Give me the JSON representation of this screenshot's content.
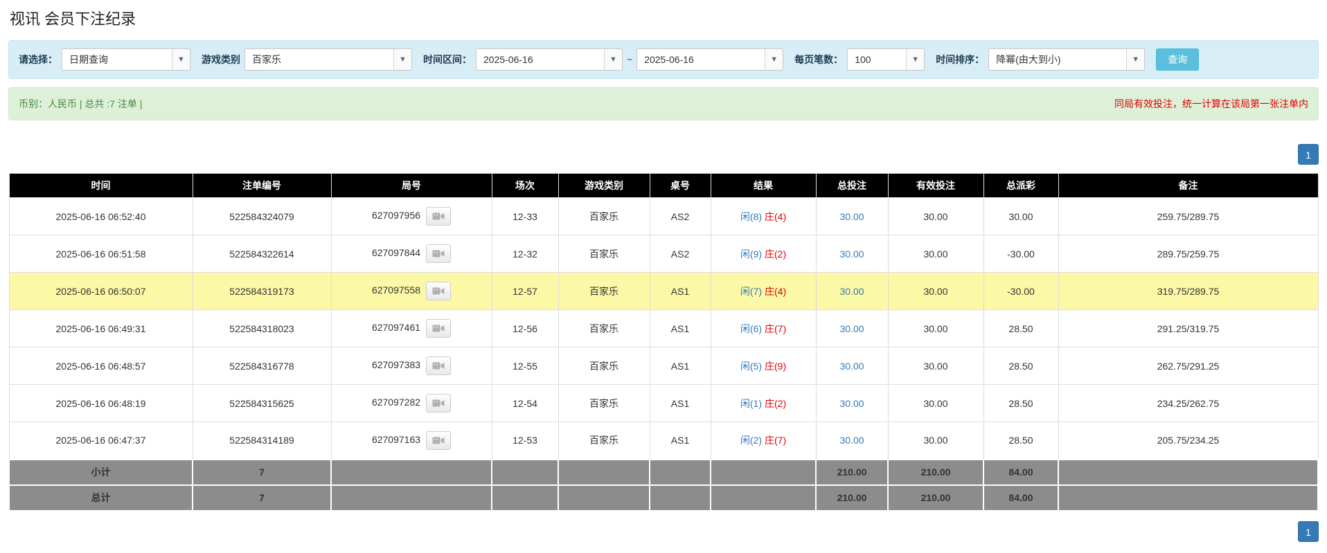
{
  "page": {
    "title": "视讯 会员下注纪录"
  },
  "filters": {
    "query_type": {
      "label": "请选择：",
      "value": "日期查询"
    },
    "game_category": {
      "label": "游戏类别",
      "value": "百家乐"
    },
    "time_range": {
      "label": "时间区间：",
      "from": "2025-06-16",
      "separator": "~",
      "to": "2025-06-16"
    },
    "page_size": {
      "label": "每页笔数：",
      "value": "100"
    },
    "time_sort": {
      "label": "时间排序：",
      "value": "降幂(由大到小)"
    },
    "search_button_label": "查询"
  },
  "summary": {
    "left_text": "币别：人民币 | 总共 :7 注单 |",
    "right_notice": "同局有效投注，统一计算在该局第一张注单内"
  },
  "pagination": {
    "current_page": "1"
  },
  "icons": {
    "dropdown": "▼",
    "video_replay": "video-camera"
  },
  "colors": {
    "accent_blue": "#337ab7",
    "result_red": "#e00000",
    "search_button_bg": "#5bc0de",
    "highlight_row": "#fbf8a6",
    "table_header_bg": "#000000",
    "totals_row_bg": "#8c8c8c",
    "filter_bar_bg": "#d9edf7",
    "summary_bar_bg": "#dff0d8"
  },
  "table": {
    "headers": [
      "时间",
      "注单编号",
      "局号",
      "场次",
      "游戏类别",
      "桌号",
      "结果",
      "总投注",
      "有效投注",
      "总派彩",
      "备注"
    ],
    "rows": [
      {
        "time": "2025-06-16 06:52:40",
        "bet_id": "522584324079",
        "round_no": "627097956",
        "session": "12-33",
        "game": "百家乐",
        "table_no": "AS2",
        "result_player": "闲(8)",
        "result_banker": "庄(4)",
        "total_bet": "30.00",
        "valid_bet": "30.00",
        "payout": "30.00",
        "note": "259.75/289.75",
        "highlighted": false
      },
      {
        "time": "2025-06-16 06:51:58",
        "bet_id": "522584322614",
        "round_no": "627097844",
        "session": "12-32",
        "game": "百家乐",
        "table_no": "AS2",
        "result_player": "闲(9)",
        "result_banker": "庄(2)",
        "total_bet": "30.00",
        "valid_bet": "30.00",
        "payout": "-30.00",
        "note": "289.75/259.75",
        "highlighted": false
      },
      {
        "time": "2025-06-16 06:50:07",
        "bet_id": "522584319173",
        "round_no": "627097558",
        "session": "12-57",
        "game": "百家乐",
        "table_no": "AS1",
        "result_player": "闲(7)",
        "result_banker": "庄(4)",
        "total_bet": "30.00",
        "valid_bet": "30.00",
        "payout": "-30.00",
        "note": "319.75/289.75",
        "highlighted": true
      },
      {
        "time": "2025-06-16 06:49:31",
        "bet_id": "522584318023",
        "round_no": "627097461",
        "session": "12-56",
        "game": "百家乐",
        "table_no": "AS1",
        "result_player": "闲(6)",
        "result_banker": "庄(7)",
        "total_bet": "30.00",
        "valid_bet": "30.00",
        "payout": "28.50",
        "note": "291.25/319.75",
        "highlighted": false
      },
      {
        "time": "2025-06-16 06:48:57",
        "bet_id": "522584316778",
        "round_no": "627097383",
        "session": "12-55",
        "game": "百家乐",
        "table_no": "AS1",
        "result_player": "闲(5)",
        "result_banker": "庄(9)",
        "total_bet": "30.00",
        "valid_bet": "30.00",
        "payout": "28.50",
        "note": "262.75/291.25",
        "highlighted": false
      },
      {
        "time": "2025-06-16 06:48:19",
        "bet_id": "522584315625",
        "round_no": "627097282",
        "session": "12-54",
        "game": "百家乐",
        "table_no": "AS1",
        "result_player": "闲(1)",
        "result_banker": "庄(2)",
        "total_bet": "30.00",
        "valid_bet": "30.00",
        "payout": "28.50",
        "note": "234.25/262.75",
        "highlighted": false
      },
      {
        "time": "2025-06-16 06:47:37",
        "bet_id": "522584314189",
        "round_no": "627097163",
        "session": "12-53",
        "game": "百家乐",
        "table_no": "AS1",
        "result_player": "闲(2)",
        "result_banker": "庄(7)",
        "total_bet": "30.00",
        "valid_bet": "30.00",
        "payout": "28.50",
        "note": "205.75/234.25",
        "highlighted": false
      }
    ],
    "subtotal_row": {
      "label": "小计",
      "count": "7",
      "total_bet": "210.00",
      "valid_bet": "210.00",
      "total_payout": "84.00"
    },
    "total_row": {
      "label": "总计",
      "count": "7",
      "total_bet": "210.00",
      "valid_bet": "210.00",
      "total_payout": "84.00"
    }
  }
}
